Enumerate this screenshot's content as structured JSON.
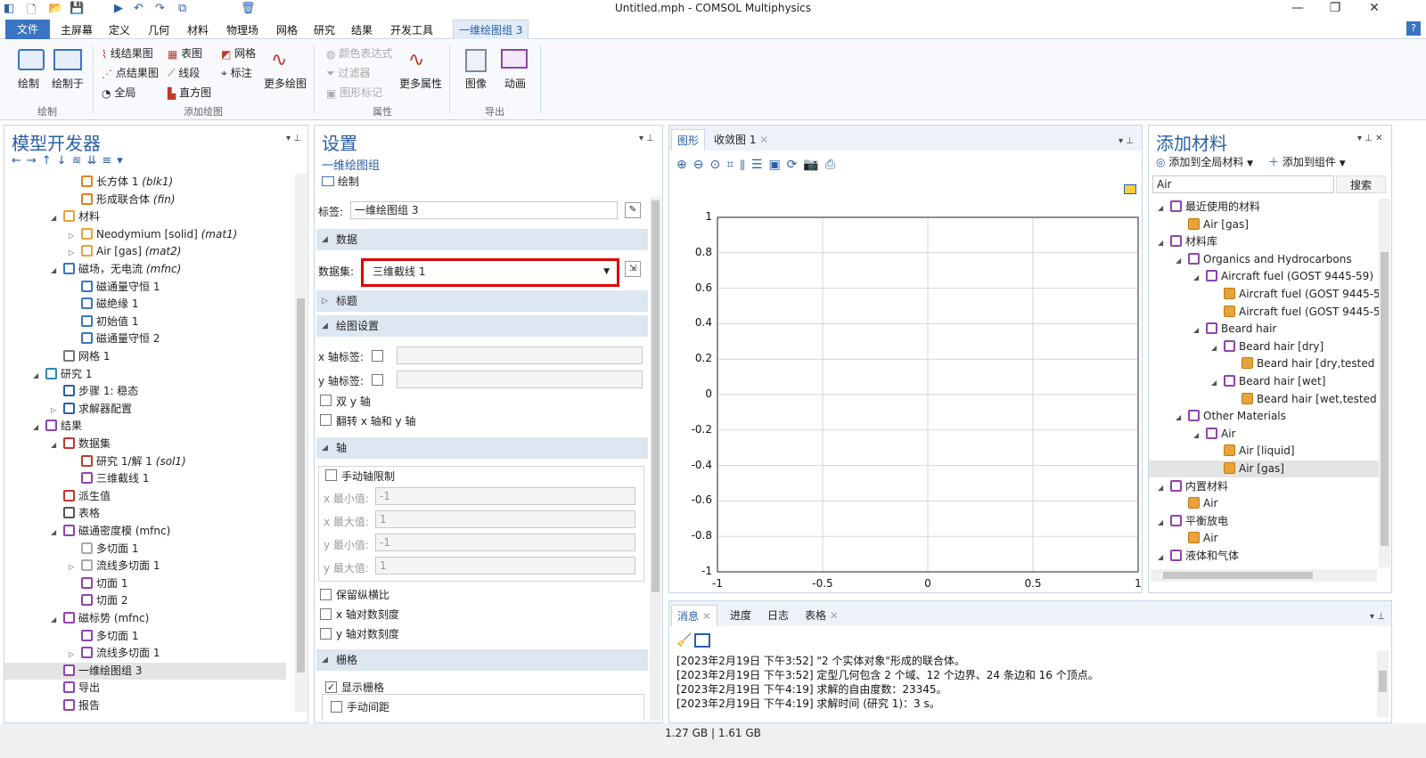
{
  "window": {
    "title": "Untitled.mph - COMSOL Multiphysics"
  },
  "menu": {
    "file": "文件",
    "items": [
      "主屏幕",
      "定义",
      "几何",
      "材料",
      "物理场",
      "网格",
      "研究",
      "结果",
      "开发工具"
    ],
    "context_tab": "一维绘图组 3",
    "help": "?"
  },
  "ribbon": {
    "plot": "绘制",
    "plot_in": "绘制于",
    "group_plot": "绘制",
    "line_graph": "线结果图",
    "point_graph": "点结果图",
    "global": "全局",
    "table_graph": "表图",
    "line_segments": "线段",
    "histogram": "直方图",
    "mesh": "网格",
    "annotation": "标注",
    "more_plots": "更多绘图",
    "group_add": "添加绘图",
    "color_expr": "颜色表达式",
    "filter": "过滤器",
    "graph_marker": "图形标记",
    "more_attrs": "更多属性",
    "group_attrs": "属性",
    "image": "图像",
    "animation": "动画",
    "group_export": "导出"
  },
  "model_builder": {
    "title": "模型开发器",
    "tree": [
      {
        "label": "长方体 1 ",
        "tag": "(blk1)",
        "level": 4
      },
      {
        "label": "形成联合体 ",
        "tag": "(fin)",
        "level": 4
      },
      {
        "label": "材料",
        "tag": "",
        "level": 3
      },
      {
        "label": "Neodymium [solid] ",
        "tag": "(mat1)",
        "level": 4
      },
      {
        "label": "Air [gas] ",
        "tag": "(mat2)",
        "level": 4
      },
      {
        "label": "磁场，无电流 ",
        "tag": "(mfnc)",
        "level": 3
      },
      {
        "label": "磁通量守恒 1",
        "tag": "",
        "level": 4
      },
      {
        "label": "磁绝缘 1",
        "tag": "",
        "level": 4
      },
      {
        "label": "初始值 1",
        "tag": "",
        "level": 4
      },
      {
        "label": "磁通量守恒 2",
        "tag": "",
        "level": 4
      },
      {
        "label": "网格 1",
        "tag": "",
        "level": 3
      },
      {
        "label": "研究 1",
        "tag": "",
        "level": 2
      },
      {
        "label": "步骤 1: 稳态",
        "tag": "",
        "level": 3
      },
      {
        "label": "求解器配置",
        "tag": "",
        "level": 3
      },
      {
        "label": "结果",
        "tag": "",
        "level": 2
      },
      {
        "label": "数据集",
        "tag": "",
        "level": 3
      },
      {
        "label": "研究 1/解 1 ",
        "tag": "(sol1)",
        "level": 4
      },
      {
        "label": "三维截线 1",
        "tag": "",
        "level": 4
      },
      {
        "label": "派生值",
        "tag": "",
        "level": 3
      },
      {
        "label": "表格",
        "tag": "",
        "level": 3
      },
      {
        "label": "磁通密度模 (mfnc)",
        "tag": "",
        "level": 3
      },
      {
        "label": "多切面 1",
        "tag": "",
        "level": 4
      },
      {
        "label": "流线多切面 1",
        "tag": "",
        "level": 4
      },
      {
        "label": "切面 1",
        "tag": "",
        "level": 4
      },
      {
        "label": "切面 2",
        "tag": "",
        "level": 4
      },
      {
        "label": "磁标势 (mfnc)",
        "tag": "",
        "level": 3
      },
      {
        "label": "多切面 1",
        "tag": "",
        "level": 4
      },
      {
        "label": "流线多切面 1",
        "tag": "",
        "level": 4
      },
      {
        "label": "一维绘图组 3",
        "tag": "",
        "level": 3
      },
      {
        "label": "导出",
        "tag": "",
        "level": 3
      },
      {
        "label": "报告",
        "tag": "",
        "level": 3
      }
    ]
  },
  "settings": {
    "title": "设置",
    "subtitle": "一维绘图组",
    "plot_btn": "绘制",
    "label_caption": "标签:",
    "label_value": "一维绘图组 3",
    "sec_data": "数据",
    "dataset_caption": "数据集:",
    "dataset_value": "三维截线 1",
    "sec_title": "标题",
    "sec_plot_settings": "绘图设置",
    "x_axis_label": "x 轴标签:",
    "y_axis_label": "y 轴标签:",
    "dual_y": "双 y 轴",
    "flip": "翻转 x 轴和 y 轴",
    "sec_axis": "轴",
    "manual_limits": "手动轴限制",
    "xmin_caption": "x 最小值:",
    "xmin": "-1",
    "xmax_caption": "x 最大值:",
    "xmax": "1",
    "ymin_caption": "y 最小值:",
    "ymin": "-1",
    "ymax_caption": "y 最大值:",
    "ymax": "1",
    "keep_aspect": "保留纵横比",
    "x_log": "x 轴对数刻度",
    "y_log": "y 轴对数刻度",
    "sec_grid": "栅格",
    "show_grid": "显示栅格",
    "manual_spacing": "手动间距"
  },
  "graphics": {
    "tab1": "图形",
    "tab2": "收敛图 1",
    "yticks": [
      "1",
      "0.8",
      "0.6",
      "0.4",
      "0.2",
      "0",
      "-0.2",
      "-0.4",
      "-0.6",
      "-0.8",
      "-1"
    ],
    "xticks": [
      "-1",
      "-0.5",
      "0",
      "0.5",
      "1"
    ]
  },
  "chart_data": {
    "type": "line",
    "series": [],
    "xlim": [
      -1,
      1
    ],
    "ylim": [
      -1,
      1
    ],
    "xticks": [
      -1,
      -0.5,
      0,
      0.5,
      1
    ],
    "yticks": [
      -1,
      -0.8,
      -0.6,
      -0.4,
      -0.2,
      0,
      0.2,
      0.4,
      0.6,
      0.8,
      1
    ],
    "grid": true,
    "title": "",
    "xlabel": "",
    "ylabel": ""
  },
  "messages": {
    "tabs": [
      "消息",
      "进度",
      "日志",
      "表格"
    ],
    "lines": [
      "[2023年2月19日 下午3:52] \"2 个实体对象\"形成的联合体。",
      "[2023年2月19日 下午3:52] 定型几何包含 2 个域、12 个边界、24 条边和 16 个顶点。",
      "[2023年2月19日 下午4:19] 求解的自由度数：23345。",
      "[2023年2月19日 下午4:19] 求解时间 (研究 1)：3 s。"
    ]
  },
  "materials": {
    "title": "添加材料",
    "add_global": "添加到全局材料",
    "add_component": "添加到组件",
    "search_value": "Air",
    "search_btn": "搜索",
    "tree": [
      {
        "label": "最近使用的材料",
        "level": 1
      },
      {
        "label": "Air [gas]",
        "level": 2
      },
      {
        "label": "材料库",
        "level": 1
      },
      {
        "label": "Organics and Hydrocarbons",
        "level": 2
      },
      {
        "label": "Aircraft fuel (GOST 9445-59)",
        "level": 3
      },
      {
        "label": "Aircraft fuel (GOST 9445-5",
        "level": 4
      },
      {
        "label": "Aircraft fuel (GOST 9445-5",
        "level": 4
      },
      {
        "label": "Beard hair",
        "level": 3
      },
      {
        "label": "Beard hair [dry]",
        "level": 4
      },
      {
        "label": "Beard hair [dry,tested",
        "level": 5
      },
      {
        "label": "Beard hair [wet]",
        "level": 4
      },
      {
        "label": "Beard hair [wet,tested",
        "level": 5
      },
      {
        "label": "Other Materials",
        "level": 2
      },
      {
        "label": "Air",
        "level": 3
      },
      {
        "label": "Air [liquid]",
        "level": 4
      },
      {
        "label": "Air [gas]",
        "level": 4
      },
      {
        "label": "内置材料",
        "level": 1
      },
      {
        "label": "Air",
        "level": 2
      },
      {
        "label": "平衡放电",
        "level": 1
      },
      {
        "label": "Air",
        "level": 2
      },
      {
        "label": "液体和气体",
        "level": 1
      }
    ]
  },
  "status": {
    "memory": "1.27 GB | 1.61 GB"
  }
}
